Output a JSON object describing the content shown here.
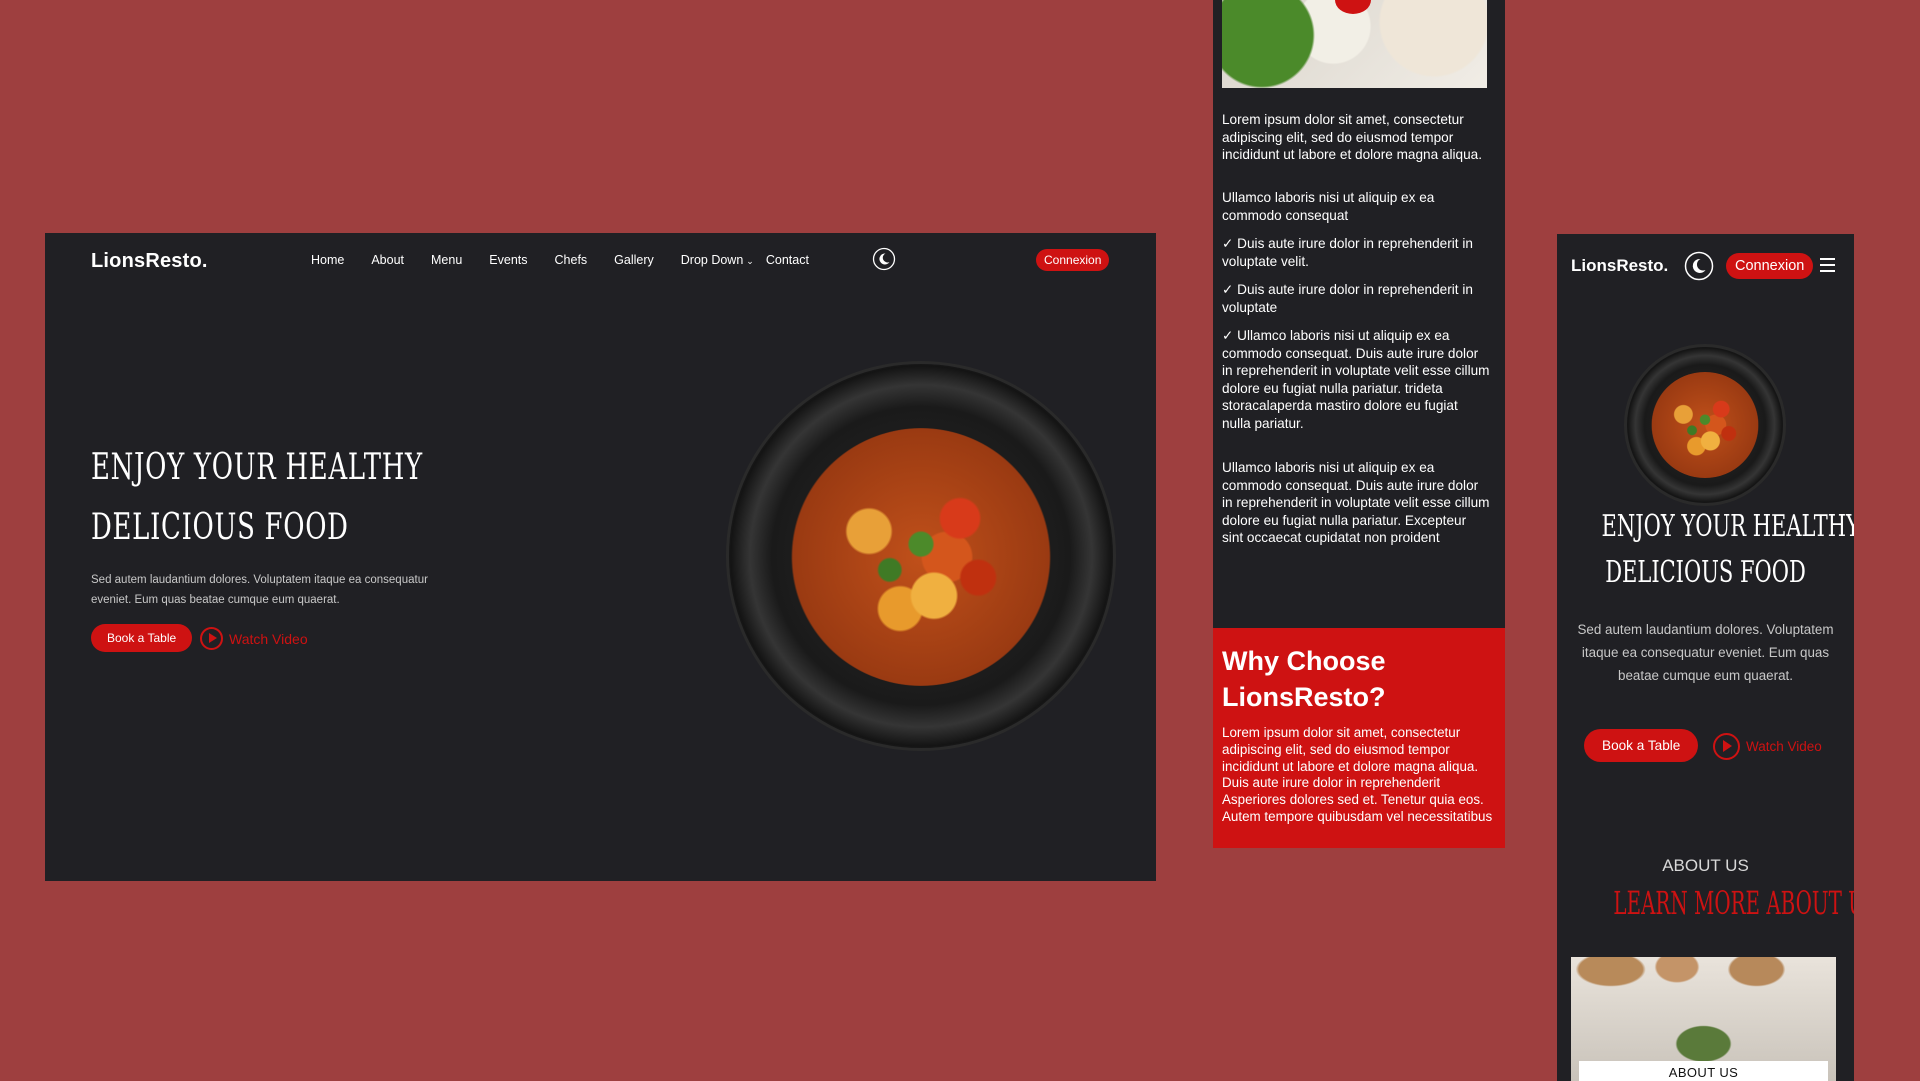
{
  "brand": "LionsResto.",
  "colors": {
    "background": "#9e3f3f",
    "panel": "#202024",
    "accent": "#ce1212"
  },
  "desktop": {
    "nav": [
      "Home",
      "About",
      "Menu",
      "Events",
      "Chefs",
      "Gallery",
      "Drop Down",
      "Contact"
    ],
    "theme_icon": "moon-icon",
    "cta": "Connexion",
    "hero_title_line1": "Enjoy Your Healthy",
    "hero_title_line2": "Delicious Food",
    "hero_sub": "Sed autem laudantium dolores. Voluptatem itaque ea consequatur eveniet. Eum quas beatae cumque eum quaerat.",
    "book": "Book a Table",
    "watch": "Watch Video"
  },
  "middle": {
    "para1": "Lorem ipsum dolor sit amet, consectetur adipiscing elit, sed do eiusmod tempor incididunt ut labore et dolore magna aliqua.",
    "para2": "Ullamco laboris nisi ut aliquip ex ea commodo consequat",
    "check1": "✓ Duis aute irure dolor in reprehenderit in voluptate velit.",
    "check2": "✓ Duis aute irure dolor in reprehenderit in voluptate",
    "check3": "✓ Ullamco laboris nisi ut aliquip ex ea commodo consequat. Duis aute irure dolor in reprehenderit in voluptate velit esse cillum dolore eu fugiat nulla pariatur. trideta storacalaperda mastiro dolore eu fugiat nulla pariatur.",
    "para3": "Ullamco laboris nisi ut aliquip ex ea commodo consequat. Duis aute irure dolor in reprehenderit in voluptate velit esse cillum dolore eu fugiat nulla pariatur. Excepteur sint occaecat cupidatat non proident",
    "why_title": "Why Choose LionsResto?",
    "why_text": "Lorem ipsum dolor sit amet, consectetur adipiscing elit, sed do eiusmod tempor incididunt ut labore et dolore magna aliqua. Duis aute irure dolor in reprehenderit Asperiores dolores sed et. Tenetur quia eos. Autem tempore quibusdam vel necessitatibus"
  },
  "mobile": {
    "cta": "Connexion",
    "hero_title_line1": "Enjoy Your Healthy",
    "hero_title_line2": "Delicious Food",
    "hero_sub": "Sed autem laudantium dolores. Voluptatem itaque ea consequatur eveniet. Eum quas beatae cumque eum quaerat.",
    "book": "Book a Table",
    "watch": "Watch Video",
    "about_label": "ABOUT US",
    "about_title": "Learn More About Us",
    "about_caption": "ABOUT US"
  }
}
